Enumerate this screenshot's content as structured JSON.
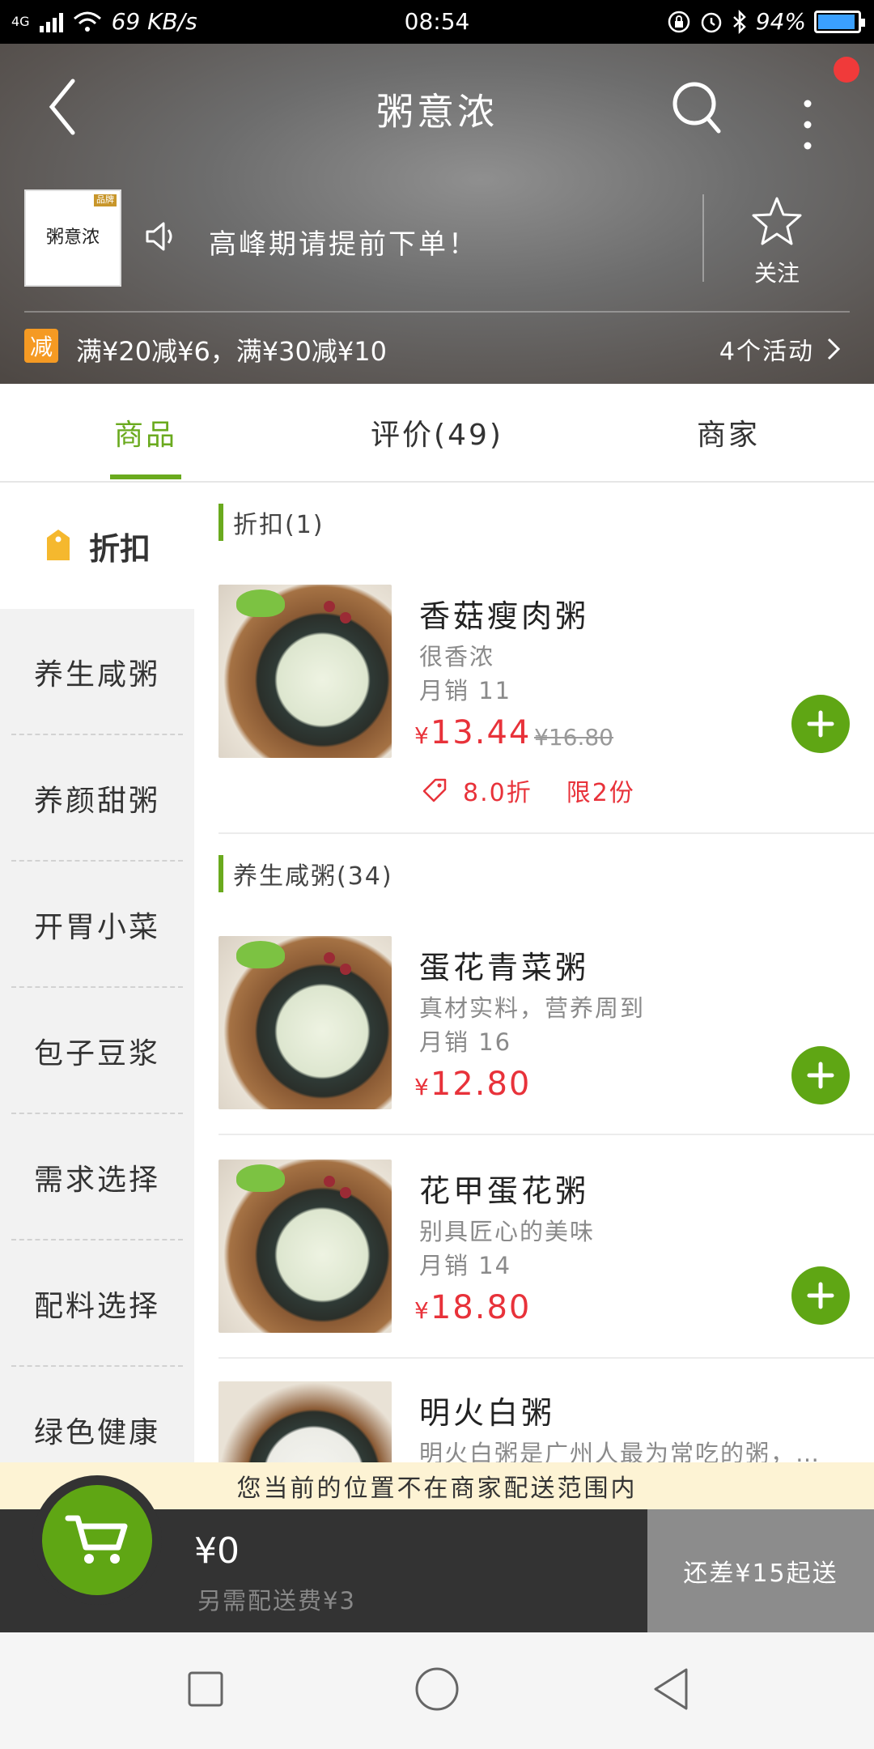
{
  "status_bar": {
    "network": "4G",
    "speed": "69 KB/s",
    "time": "08:54",
    "battery": "94%",
    "battery_level": 0.94
  },
  "header": {
    "title": "粥意浓",
    "logo_text": "粥意浓",
    "notice": "高峰期请提前下单！",
    "follow_label": "关注",
    "promo_badge": "减",
    "promo_text": "满¥20减¥6，满¥30减¥10",
    "activities": "4个活动"
  },
  "tabs": [
    {
      "label": "商品"
    },
    {
      "label": "评价(49)"
    },
    {
      "label": "商家"
    }
  ],
  "sidebar": {
    "active": "折扣",
    "items": [
      "养生咸粥",
      "养颜甜粥",
      "开胃小菜",
      "包子豆浆",
      "需求选择",
      "配料选择",
      "绿色健康"
    ]
  },
  "sections": {
    "discount_title": "折扣(1)",
    "savory_title": "养生咸粥(34)"
  },
  "products": [
    {
      "name": "香菇瘦肉粥",
      "desc": "很香浓",
      "sales": "月销 11",
      "price": "13.44",
      "orig_price": "¥16.80",
      "discount": "8.0折",
      "limit": "限2份"
    },
    {
      "name": "蛋花青菜粥",
      "desc": "真材实料，营养周到",
      "sales": "月销 16",
      "price": "12.80"
    },
    {
      "name": "花甲蛋花粥",
      "desc": "别具匠心的美味",
      "sales": "月销 14",
      "price": "18.80"
    },
    {
      "name": "明火白粥",
      "desc": "明火白粥是广州人最为常吃的粥，…"
    }
  ],
  "currency": "¥",
  "warning": "您当前的位置不在商家配送范围内",
  "cart": {
    "total": "¥0",
    "fee": "另需配送费¥3",
    "checkout": "还差¥15起送"
  },
  "colors": {
    "accent": "#6aaa1e",
    "price": "#e8323a",
    "promo": "#f59a23"
  }
}
